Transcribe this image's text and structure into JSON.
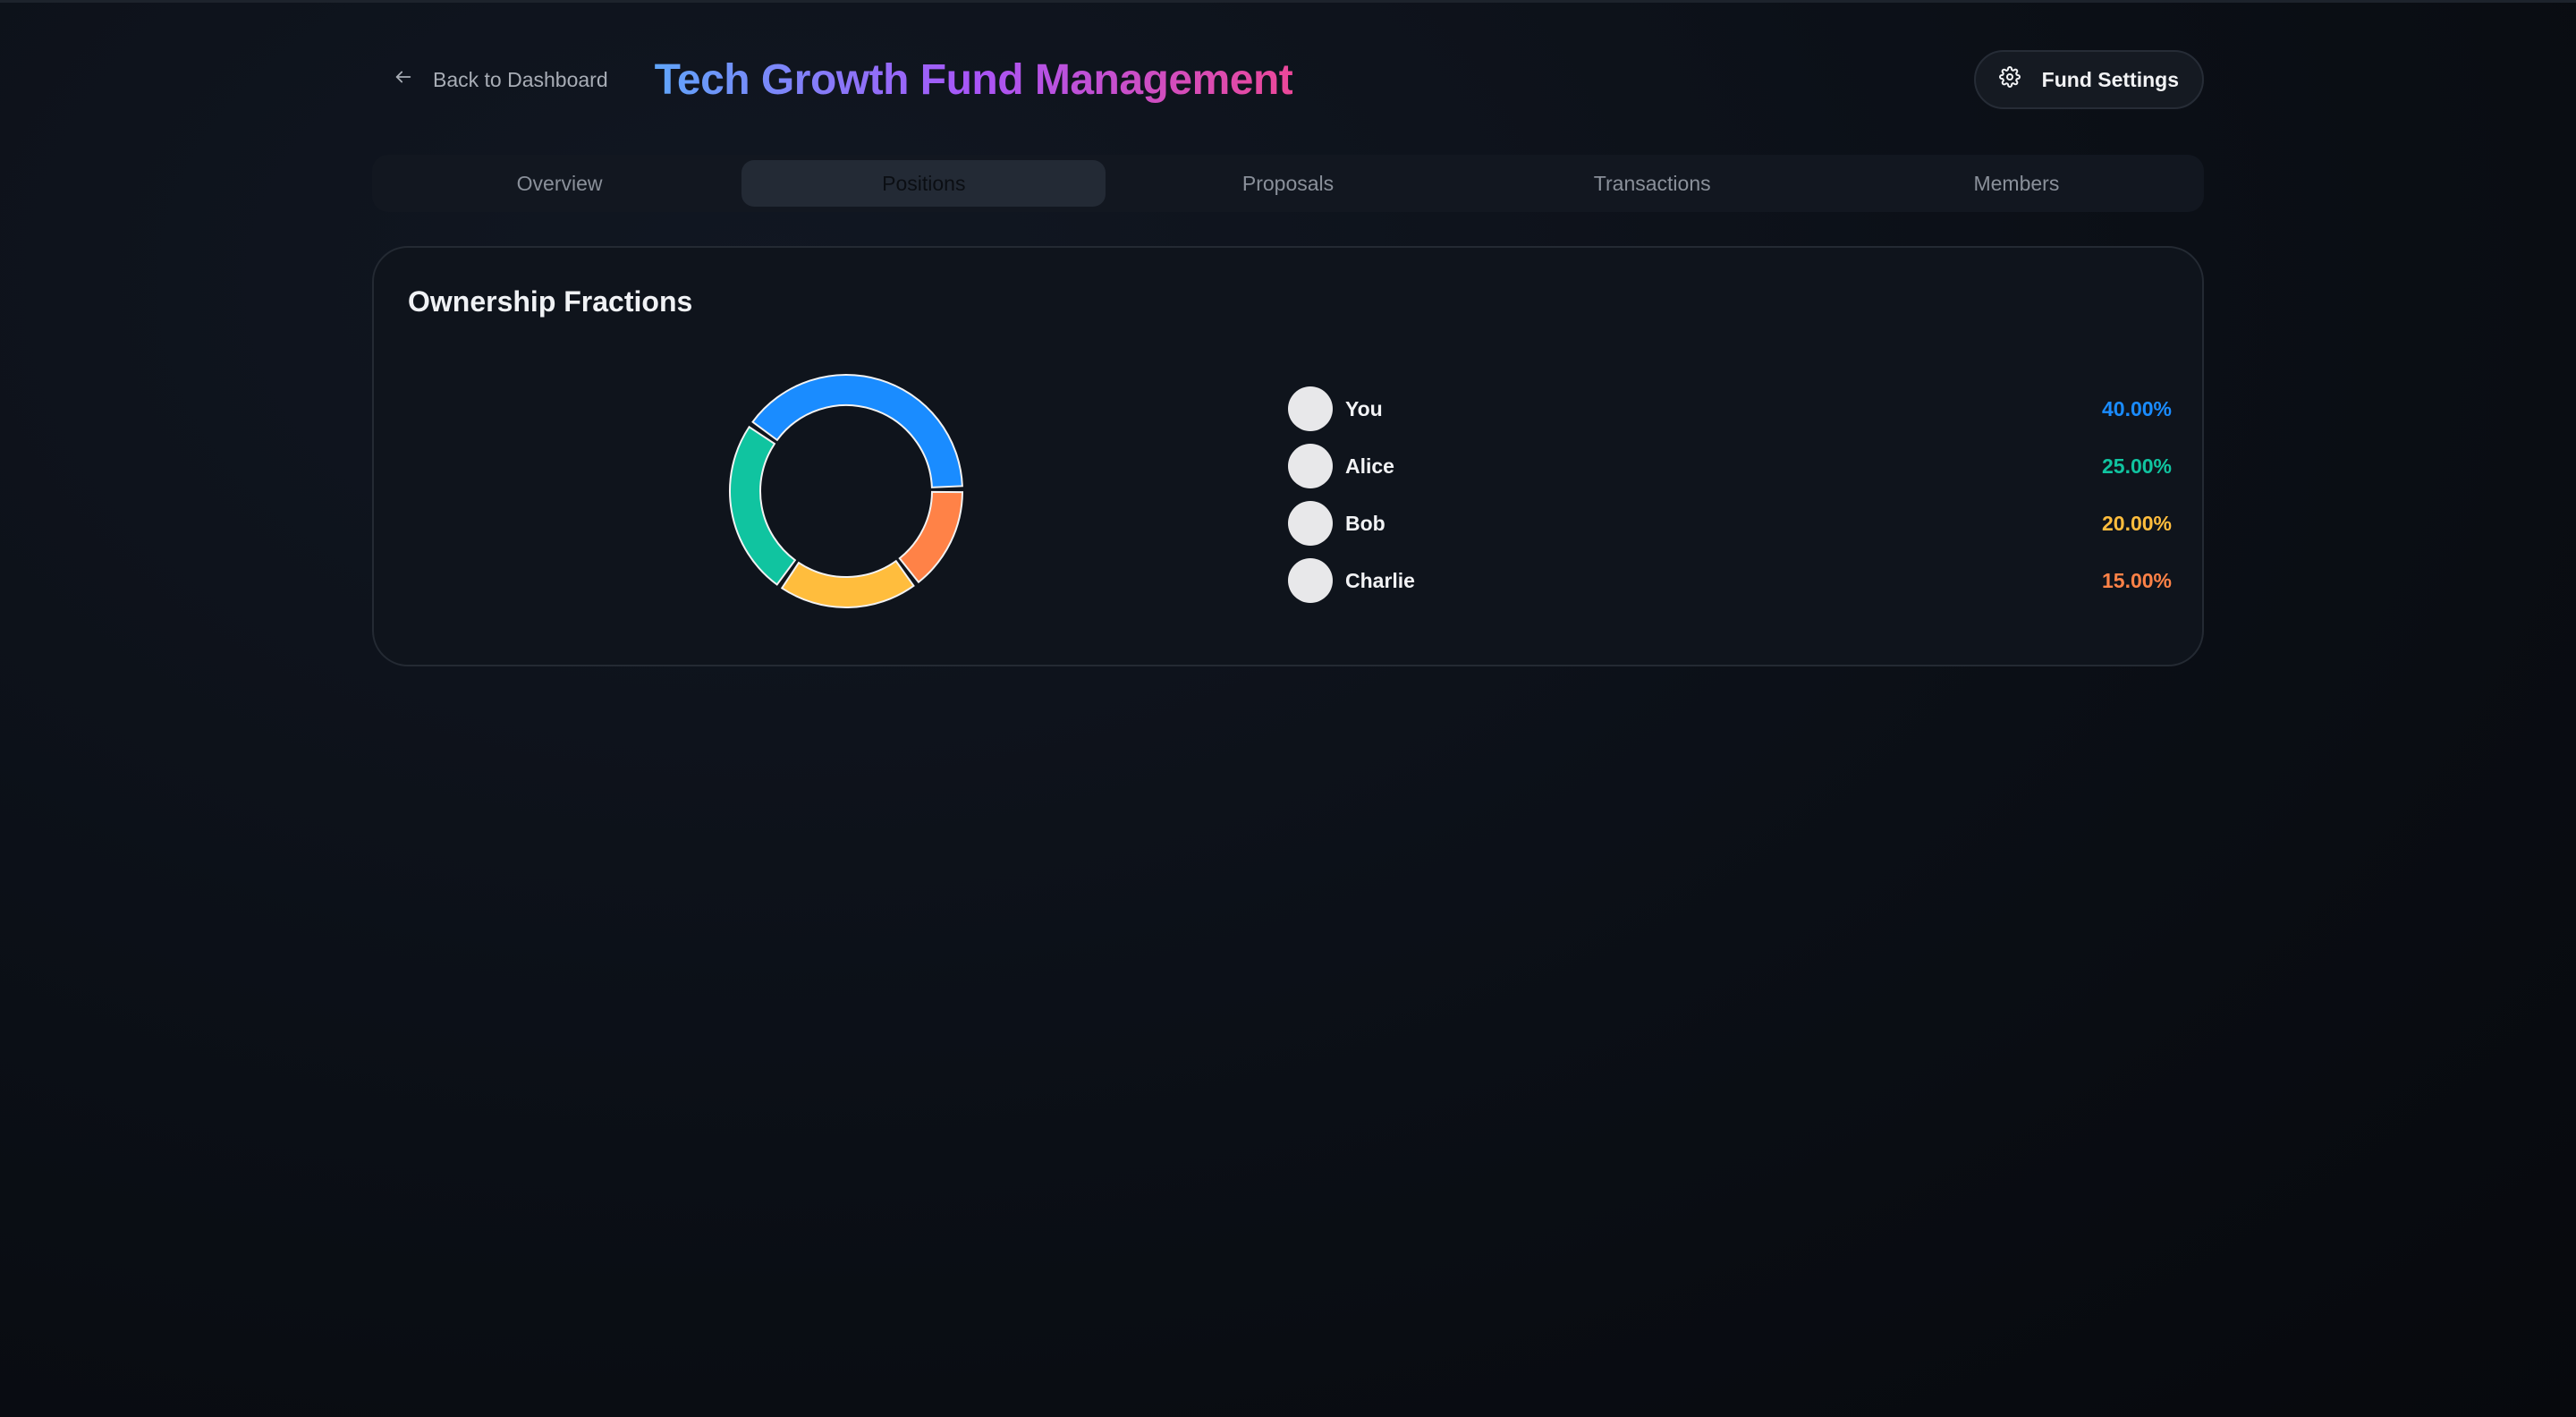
{
  "header": {
    "back_label": "Back to Dashboard",
    "title": "Tech Growth Fund Management",
    "settings_label": "Fund Settings"
  },
  "tabs": [
    {
      "label": "Overview",
      "active": false
    },
    {
      "label": "Positions",
      "active": true
    },
    {
      "label": "Proposals",
      "active": false
    },
    {
      "label": "Transactions",
      "active": false
    },
    {
      "label": "Members",
      "active": false
    }
  ],
  "ownership": {
    "title": "Ownership Fractions",
    "members": [
      {
        "name": "You",
        "value": "40.00%",
        "color": "#1a8cff"
      },
      {
        "name": "Alice",
        "value": "25.00%",
        "color": "#10c4a0"
      },
      {
        "name": "Bob",
        "value": "20.00%",
        "color": "#ffbd3d"
      },
      {
        "name": "Charlie",
        "value": "15.00%",
        "color": "#ff8247"
      }
    ]
  },
  "chart_data": {
    "type": "pie",
    "categories": [
      "You",
      "Charlie",
      "Bob",
      "Alice"
    ],
    "values": [
      40,
      15,
      20,
      25
    ],
    "colors": [
      "#1a8cff",
      "#ff8247",
      "#ffbd3d",
      "#10c4a0"
    ]
  }
}
